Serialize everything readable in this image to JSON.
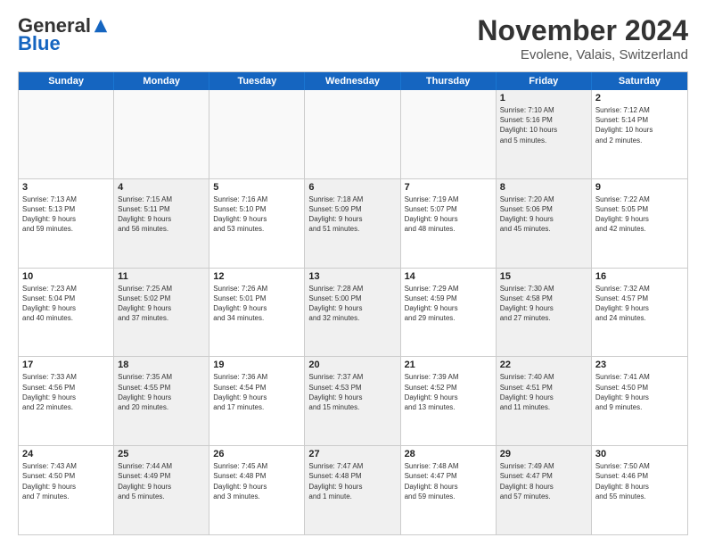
{
  "logo": {
    "general": "General",
    "blue": "Blue"
  },
  "title": "November 2024",
  "subtitle": "Evolene, Valais, Switzerland",
  "header_days": [
    "Sunday",
    "Monday",
    "Tuesday",
    "Wednesday",
    "Thursday",
    "Friday",
    "Saturday"
  ],
  "weeks": [
    [
      {
        "day": "",
        "info": "",
        "empty": true
      },
      {
        "day": "",
        "info": "",
        "empty": true
      },
      {
        "day": "",
        "info": "",
        "empty": true
      },
      {
        "day": "",
        "info": "",
        "empty": true
      },
      {
        "day": "",
        "info": "",
        "empty": true
      },
      {
        "day": "1",
        "info": "Sunrise: 7:10 AM\nSunset: 5:16 PM\nDaylight: 10 hours\nand 5 minutes.",
        "shaded": true
      },
      {
        "day": "2",
        "info": "Sunrise: 7:12 AM\nSunset: 5:14 PM\nDaylight: 10 hours\nand 2 minutes.",
        "shaded": false
      }
    ],
    [
      {
        "day": "3",
        "info": "Sunrise: 7:13 AM\nSunset: 5:13 PM\nDaylight: 9 hours\nand 59 minutes.",
        "shaded": false
      },
      {
        "day": "4",
        "info": "Sunrise: 7:15 AM\nSunset: 5:11 PM\nDaylight: 9 hours\nand 56 minutes.",
        "shaded": true
      },
      {
        "day": "5",
        "info": "Sunrise: 7:16 AM\nSunset: 5:10 PM\nDaylight: 9 hours\nand 53 minutes.",
        "shaded": false
      },
      {
        "day": "6",
        "info": "Sunrise: 7:18 AM\nSunset: 5:09 PM\nDaylight: 9 hours\nand 51 minutes.",
        "shaded": true
      },
      {
        "day": "7",
        "info": "Sunrise: 7:19 AM\nSunset: 5:07 PM\nDaylight: 9 hours\nand 48 minutes.",
        "shaded": false
      },
      {
        "day": "8",
        "info": "Sunrise: 7:20 AM\nSunset: 5:06 PM\nDaylight: 9 hours\nand 45 minutes.",
        "shaded": true
      },
      {
        "day": "9",
        "info": "Sunrise: 7:22 AM\nSunset: 5:05 PM\nDaylight: 9 hours\nand 42 minutes.",
        "shaded": false
      }
    ],
    [
      {
        "day": "10",
        "info": "Sunrise: 7:23 AM\nSunset: 5:04 PM\nDaylight: 9 hours\nand 40 minutes.",
        "shaded": false
      },
      {
        "day": "11",
        "info": "Sunrise: 7:25 AM\nSunset: 5:02 PM\nDaylight: 9 hours\nand 37 minutes.",
        "shaded": true
      },
      {
        "day": "12",
        "info": "Sunrise: 7:26 AM\nSunset: 5:01 PM\nDaylight: 9 hours\nand 34 minutes.",
        "shaded": false
      },
      {
        "day": "13",
        "info": "Sunrise: 7:28 AM\nSunset: 5:00 PM\nDaylight: 9 hours\nand 32 minutes.",
        "shaded": true
      },
      {
        "day": "14",
        "info": "Sunrise: 7:29 AM\nSunset: 4:59 PM\nDaylight: 9 hours\nand 29 minutes.",
        "shaded": false
      },
      {
        "day": "15",
        "info": "Sunrise: 7:30 AM\nSunset: 4:58 PM\nDaylight: 9 hours\nand 27 minutes.",
        "shaded": true
      },
      {
        "day": "16",
        "info": "Sunrise: 7:32 AM\nSunset: 4:57 PM\nDaylight: 9 hours\nand 24 minutes.",
        "shaded": false
      }
    ],
    [
      {
        "day": "17",
        "info": "Sunrise: 7:33 AM\nSunset: 4:56 PM\nDaylight: 9 hours\nand 22 minutes.",
        "shaded": false
      },
      {
        "day": "18",
        "info": "Sunrise: 7:35 AM\nSunset: 4:55 PM\nDaylight: 9 hours\nand 20 minutes.",
        "shaded": true
      },
      {
        "day": "19",
        "info": "Sunrise: 7:36 AM\nSunset: 4:54 PM\nDaylight: 9 hours\nand 17 minutes.",
        "shaded": false
      },
      {
        "day": "20",
        "info": "Sunrise: 7:37 AM\nSunset: 4:53 PM\nDaylight: 9 hours\nand 15 minutes.",
        "shaded": true
      },
      {
        "day": "21",
        "info": "Sunrise: 7:39 AM\nSunset: 4:52 PM\nDaylight: 9 hours\nand 13 minutes.",
        "shaded": false
      },
      {
        "day": "22",
        "info": "Sunrise: 7:40 AM\nSunset: 4:51 PM\nDaylight: 9 hours\nand 11 minutes.",
        "shaded": true
      },
      {
        "day": "23",
        "info": "Sunrise: 7:41 AM\nSunset: 4:50 PM\nDaylight: 9 hours\nand 9 minutes.",
        "shaded": false
      }
    ],
    [
      {
        "day": "24",
        "info": "Sunrise: 7:43 AM\nSunset: 4:50 PM\nDaylight: 9 hours\nand 7 minutes.",
        "shaded": false
      },
      {
        "day": "25",
        "info": "Sunrise: 7:44 AM\nSunset: 4:49 PM\nDaylight: 9 hours\nand 5 minutes.",
        "shaded": true
      },
      {
        "day": "26",
        "info": "Sunrise: 7:45 AM\nSunset: 4:48 PM\nDaylight: 9 hours\nand 3 minutes.",
        "shaded": false
      },
      {
        "day": "27",
        "info": "Sunrise: 7:47 AM\nSunset: 4:48 PM\nDaylight: 9 hours\nand 1 minute.",
        "shaded": true
      },
      {
        "day": "28",
        "info": "Sunrise: 7:48 AM\nSunset: 4:47 PM\nDaylight: 8 hours\nand 59 minutes.",
        "shaded": false
      },
      {
        "day": "29",
        "info": "Sunrise: 7:49 AM\nSunset: 4:47 PM\nDaylight: 8 hours\nand 57 minutes.",
        "shaded": true
      },
      {
        "day": "30",
        "info": "Sunrise: 7:50 AM\nSunset: 4:46 PM\nDaylight: 8 hours\nand 55 minutes.",
        "shaded": false
      }
    ]
  ]
}
